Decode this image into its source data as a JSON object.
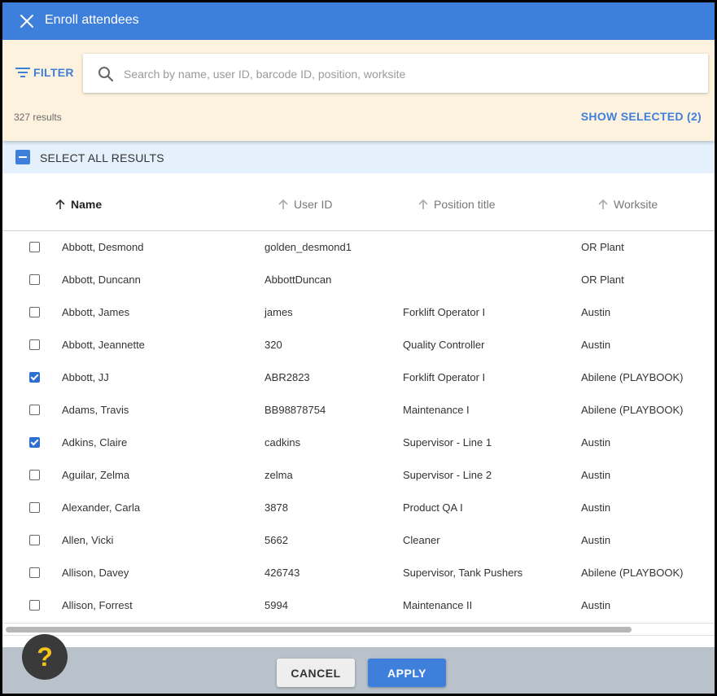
{
  "dialog": {
    "title": "Enroll attendees"
  },
  "filter": {
    "label": "FILTER",
    "search_placeholder": "Search by name, user ID, barcode ID, position, worksite",
    "results_count": "327 results",
    "show_selected": "SHOW SELECTED (2)"
  },
  "select_all": {
    "label": "SELECT ALL RESULTS",
    "state": "indeterminate"
  },
  "columns": [
    {
      "label": "Name",
      "sorted": true
    },
    {
      "label": "User ID",
      "sorted": false
    },
    {
      "label": "Position title",
      "sorted": false
    },
    {
      "label": "Worksite",
      "sorted": false
    }
  ],
  "rows": [
    {
      "checked": false,
      "name": "Abbott, Desmond",
      "user_id": "golden_desmond1",
      "position": "",
      "worksite": "OR Plant"
    },
    {
      "checked": false,
      "name": "Abbott, Duncann",
      "user_id": "AbbottDuncan",
      "position": "",
      "worksite": "OR Plant"
    },
    {
      "checked": false,
      "name": "Abbott, James",
      "user_id": "james",
      "position": "Forklift Operator I",
      "worksite": "Austin"
    },
    {
      "checked": false,
      "name": "Abbott, Jeannette",
      "user_id": "320",
      "position": "Quality Controller",
      "worksite": "Austin"
    },
    {
      "checked": true,
      "name": "Abbott, JJ",
      "user_id": "ABR2823",
      "position": "Forklift Operator I",
      "worksite": "Abilene (PLAYBOOK)"
    },
    {
      "checked": false,
      "name": "Adams, Travis",
      "user_id": "BB98878754",
      "position": "Maintenance I",
      "worksite": "Abilene (PLAYBOOK)"
    },
    {
      "checked": true,
      "name": "Adkins, Claire",
      "user_id": "cadkins",
      "position": "Supervisor - Line 1",
      "worksite": "Austin"
    },
    {
      "checked": false,
      "name": "Aguilar, Zelma",
      "user_id": "zelma",
      "position": "Supervisor - Line 2",
      "worksite": "Austin"
    },
    {
      "checked": false,
      "name": "Alexander, Carla",
      "user_id": "3878",
      "position": "Product QA I",
      "worksite": "Austin"
    },
    {
      "checked": false,
      "name": "Allen, Vicki",
      "user_id": "5662",
      "position": "Cleaner",
      "worksite": "Austin"
    },
    {
      "checked": false,
      "name": "Allison, Davey",
      "user_id": "426743",
      "position": "Supervisor, Tank Pushers",
      "worksite": "Abilene (PLAYBOOK)"
    },
    {
      "checked": false,
      "name": "Allison, Forrest",
      "user_id": "5994",
      "position": "Maintenance II",
      "worksite": "Austin"
    }
  ],
  "footer": {
    "cancel": "CANCEL",
    "apply": "APPLY"
  },
  "help": {
    "label": "?"
  },
  "colors": {
    "primary": "#3f7fdc",
    "filter_bg": "#fcf2de",
    "select_all_bg": "#e4f0fb",
    "footer_bg": "#b9c2ca",
    "help_icon": "#f5c518"
  }
}
